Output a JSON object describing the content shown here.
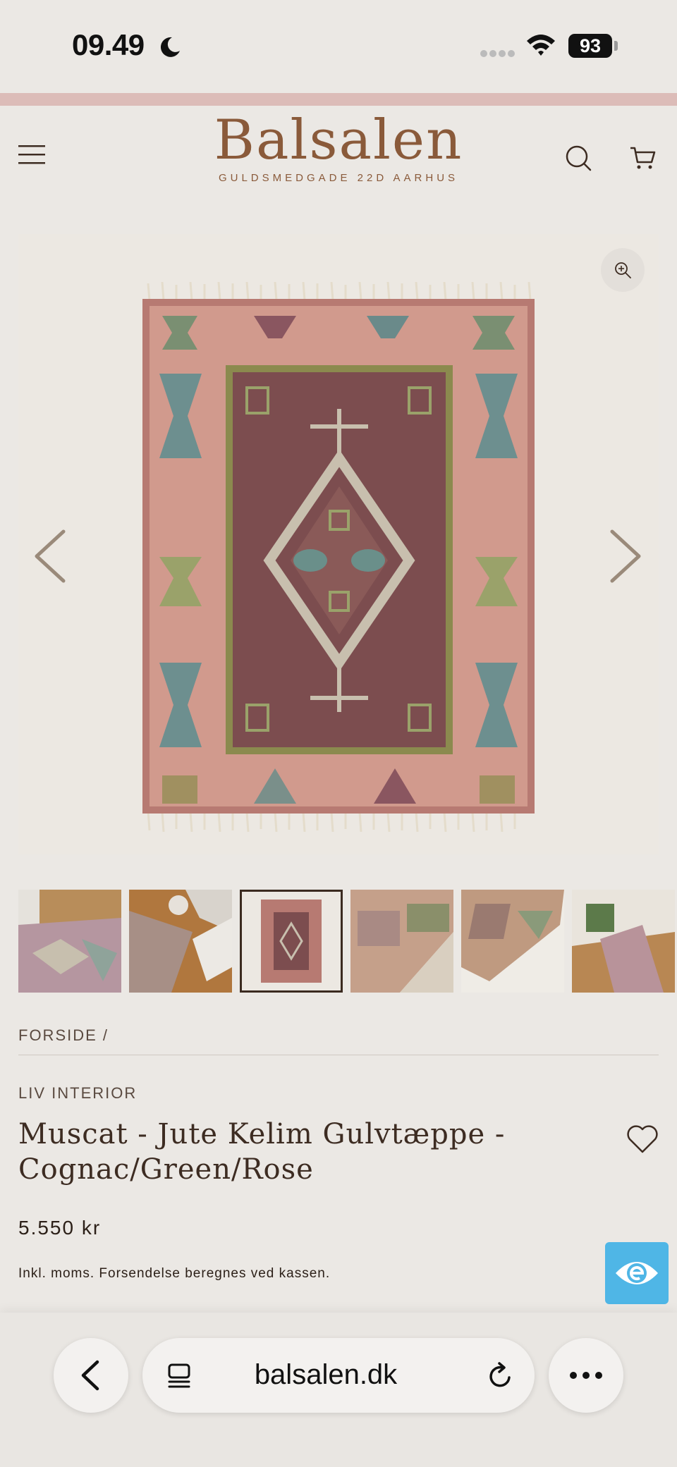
{
  "status_bar": {
    "time": "09.49",
    "battery": "93"
  },
  "header": {
    "logo_name": "Balsalen",
    "logo_subtitle": "GULDSMEDGADE 22D AARHUS"
  },
  "gallery": {
    "thumbnail_count": 6,
    "selected_index": 3
  },
  "breadcrumb": "FORSIDE /",
  "product": {
    "vendor": "LIV INTERIOR",
    "title": "Muscat - Jute Kelim Gulvtæppe - Cognac/Green/Rose",
    "price": "5.550 kr",
    "tax_note": "Inkl. moms. Forsendelse beregnes ved kassen."
  },
  "browser": {
    "url": "balsalen.dk"
  },
  "colors": {
    "background": "#ebe8e4",
    "accent_strip": "#dcbcb8",
    "brand": "#8a5a3a",
    "accessibility": "#4fb6e6"
  },
  "icons": [
    "moon-icon",
    "signal-icon",
    "wifi-icon",
    "menu-icon",
    "search-icon",
    "cart-icon",
    "zoom-icon",
    "chevron-left-icon",
    "chevron-right-icon",
    "heart-icon",
    "accessibility-eye-icon",
    "back-icon",
    "tabs-icon",
    "reload-icon",
    "more-icon"
  ]
}
